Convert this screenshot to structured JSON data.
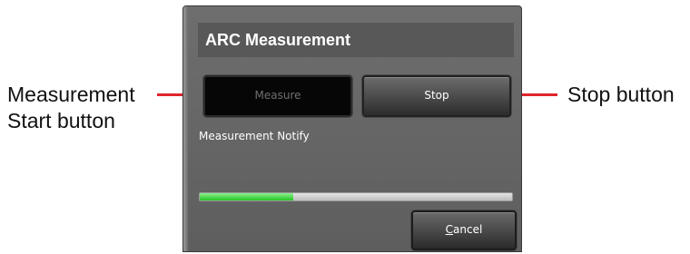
{
  "callouts": {
    "left_line1": "Measurement",
    "left_line2": "Start button",
    "right": "Stop button"
  },
  "dialog": {
    "title": "ARC Measurement",
    "measure_label": "Measure",
    "stop_label": "Stop",
    "notify_text": "Measurement Notify",
    "progress_fraction": 0.3,
    "cancel_mnemonic": "C",
    "cancel_rest": "ancel"
  },
  "colors": {
    "callout_line": "#e0242b",
    "progress_fill": "#2bd12b",
    "dialog_background": "#636363",
    "title_bar": "#585858"
  }
}
